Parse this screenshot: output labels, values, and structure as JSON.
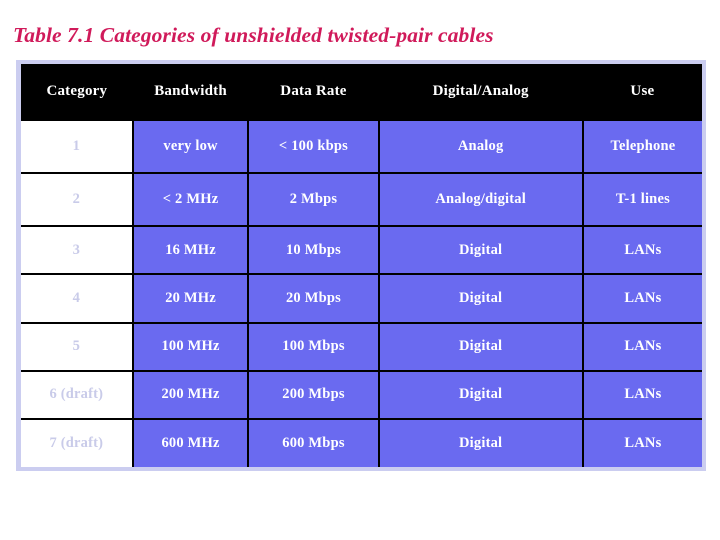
{
  "slide": {
    "title": "Table 7.1  Categories of unshielded twisted-pair cables",
    "title_color": "#d01a5a",
    "background_color": "#ffffff"
  },
  "table": {
    "frame_color": "#cbcdf0",
    "header_background": "#000000",
    "header_text_color": "#ffffff",
    "data_cell_background": "#6a6af0",
    "data_cell_text_color": "#ffffff",
    "category_cell_background": "#ffffff",
    "category_cell_text_color": "#c9cbe9",
    "headers": [
      "Category",
      "Bandwidth",
      "Data Rate",
      "Digital/Analog",
      "Use"
    ],
    "rows": [
      {
        "category": "1",
        "bandwidth": "very low",
        "data_rate": "< 100 kbps",
        "digital_analog": "Analog",
        "use": "Telephone"
      },
      {
        "category": "2",
        "bandwidth": "< 2 MHz",
        "data_rate": "2 Mbps",
        "digital_analog": "Analog/digital",
        "use": "T-1 lines"
      },
      {
        "category": "3",
        "bandwidth": "16 MHz",
        "data_rate": "10 Mbps",
        "digital_analog": "Digital",
        "use": "LANs"
      },
      {
        "category": "4",
        "bandwidth": "20 MHz",
        "data_rate": "20 Mbps",
        "digital_analog": "Digital",
        "use": "LANs"
      },
      {
        "category": "5",
        "bandwidth": "100 MHz",
        "data_rate": "100 Mbps",
        "digital_analog": "Digital",
        "use": "LANs"
      },
      {
        "category": "6 (draft)",
        "bandwidth": "200 MHz",
        "data_rate": "200 Mbps",
        "digital_analog": "Digital",
        "use": "LANs"
      },
      {
        "category": "7 (draft)",
        "bandwidth": "600 MHz",
        "data_rate": "600 Mbps",
        "digital_analog": "Digital",
        "use": "LANs"
      }
    ]
  }
}
